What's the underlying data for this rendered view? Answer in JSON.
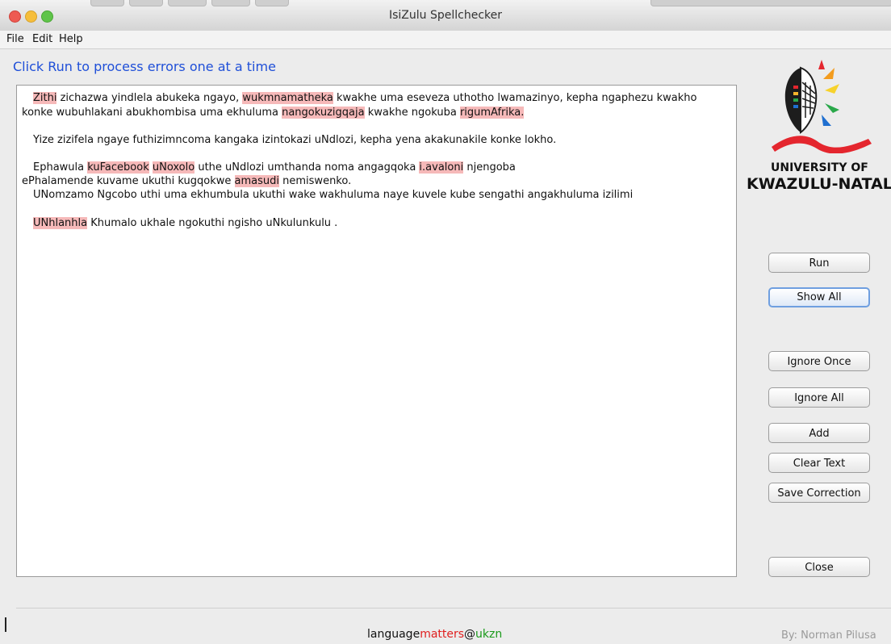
{
  "window": {
    "title": "IsiZulu Spellchecker"
  },
  "menu": {
    "items": [
      "File",
      "Edit",
      "Help"
    ]
  },
  "instruction": "Click Run to process errors one at a time",
  "document": {
    "lines": [
      [
        {
          "t": "Zithi",
          "e": true
        },
        {
          "t": " zichazwa yindlela abukeka ngayo, "
        },
        {
          "t": "wukmnamatheka",
          "e": true
        },
        {
          "t": " kwakhe uma eseveza uthotho lwamazinyo, kepha ngaphezu kwakho"
        }
      ],
      [
        {
          "t": "konke wubuhlakani abukhombisa uma ekhuluma "
        },
        {
          "t": "nangokuzigqaja",
          "e": true
        },
        {
          "t": " kwakhe ngokuba "
        },
        {
          "t": "rigumAfrika.",
          "e": true
        }
      ],
      [
        {
          "t": "Yize zizifela ngaye futhizimncoma kangaka izintokazi uNdlozi, kepha yena akakunakile konke lokho."
        }
      ],
      [
        {
          "t": "Ephawula "
        },
        {
          "t": "kuFacebook",
          "e": true
        },
        {
          "t": " "
        },
        {
          "t": "uNoxolo",
          "e": true
        },
        {
          "t": " uthe uNdlozi umthanda noma angagqoka "
        },
        {
          "t": "i.avaloni",
          "e": true
        },
        {
          "t": " njengoba"
        }
      ],
      [
        {
          "t": "ePhalamende kuvame ukuthi kugqokwe "
        },
        {
          "t": "amasudi",
          "e": true
        },
        {
          "t": " nemiswenko."
        }
      ],
      [
        {
          "t": "UNomzamo Ngcobo uthi uma ekhumbula ukuthi wake wakhuluma naye kuvele kube sengathi angakhuluma izilimi"
        }
      ],
      [
        {
          "t": "UNhlanhla",
          "e": true
        },
        {
          "t": " Khumalo ukhale ngokuthi ngisho uNkulunkulu ."
        }
      ]
    ]
  },
  "logo": {
    "line1": "UNIVERSITY OF",
    "line2": "KWAZULU-NATAL"
  },
  "buttons": {
    "run": "Run",
    "show_all": "Show All",
    "ignore_once": "Ignore Once",
    "ignore_all": "Ignore All",
    "add": "Add",
    "clear_text": "Clear Text",
    "save_correction": "Save Correction",
    "close": "Close"
  },
  "footer": {
    "brand_part1": "language",
    "brand_part2": "matters",
    "brand_part3": "@",
    "brand_part4": "ukzn",
    "credit": "By: Norman Pilusa"
  },
  "colors": {
    "error_highlight": "#f6b9b9",
    "instruction": "#1f4fd8",
    "brand_red": "#e02020",
    "brand_green": "#1a9a1a"
  }
}
